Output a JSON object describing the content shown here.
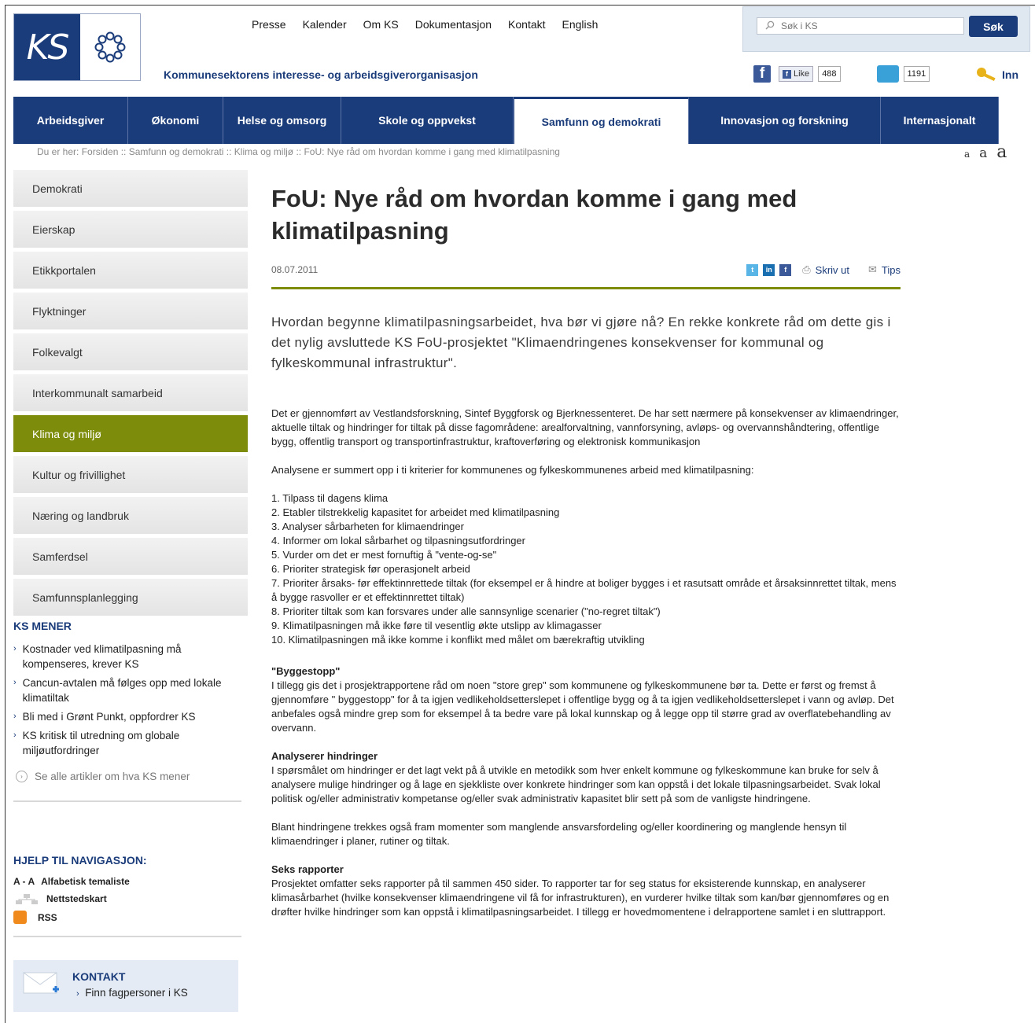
{
  "brand": {
    "logo_text": "KS",
    "tagline": "Kommunesektorens interesse- og arbeidsgiverorganisasjon"
  },
  "topnav": [
    "Presse",
    "Kalender",
    "Om KS",
    "Dokumentasjon",
    "Kontakt",
    "English"
  ],
  "search": {
    "placeholder": "Søk i KS",
    "button": "Søk"
  },
  "social": {
    "like_label": "Like",
    "like_count": "488",
    "tweet_count": "1191",
    "login": "Inn"
  },
  "mainnav": [
    "Arbeidsgiver",
    "Økonomi",
    "Helse og omsorg",
    "Skole og oppvekst",
    "Samfunn og demokrati",
    "Innovasjon og forskning",
    "Internasjonalt"
  ],
  "breadcrumb": "Du er her: Forsiden :: Samfunn og demokrati :: Klima og miljø :: FoU: Nye råd om hvordan komme i gang med klimatilpasning",
  "fontsize_glyph": "a",
  "sidebar": [
    "Demokrati",
    "Eierskap",
    "Etikkportalen",
    "Flyktninger",
    "Folkevalgt",
    "Interkommunalt samarbeid",
    "Klima og miljø",
    "Kultur og frivillighet",
    "Næring og landbruk",
    "Samferdsel",
    "Samfunnsplanlegging"
  ],
  "ks_mener": {
    "heading": "KS MENER",
    "items": [
      "Kostnader ved klimatilpasning må kompenseres, krever KS",
      "Cancun-avtalen må følges opp med lokale klimatiltak",
      "Bli med i Grønt Punkt, oppfordrer KS",
      "KS kritisk til utredning om globale miljøutfordringer"
    ],
    "see_all": "Se alle artikler om hva KS mener"
  },
  "help": {
    "heading": "HJELP TIL NAVIGASJON:",
    "az_label": "A - A",
    "alphabetic": "Alfabetisk temaliste",
    "sitemap": "Nettstedskart",
    "rss": "RSS"
  },
  "kontakt": {
    "title": "KONTAKT",
    "link": "Finn fagpersoner i KS"
  },
  "article": {
    "title": "FoU: Nye råd om hvordan komme i gang med klimatilpasning",
    "date": "08.07.2011",
    "print": "Skriv ut",
    "tips": "Tips",
    "lead": "Hvordan begynne klimatilpasningsarbeidet, hva bør vi gjøre nå? En rekke konkrete råd om dette gis i det nylig avsluttede KS FoU-prosjektet \"Klimaendringenes konsekvenser for kommunal og fylkeskommunal infrastruktur\".",
    "p1": "Det er gjennomført av Vestlandsforskning, Sintef Byggforsk og Bjerknessenteret. De har sett nærmere på konsekvenser av klimaendringer, aktuelle tiltak og hindringer for tiltak på disse fagområdene: arealforvaltning, vannforsyning, avløps- og overvannshåndtering, offentlige bygg, offentlig transport og transportinfrastruktur, kraftoverføring og elektronisk kommunikasjon",
    "p2": "Analysene er summert opp i ti kriterier for kommunenes og fylkeskommunenes arbeid med klimatilpasning:",
    "criteria": [
      "1. Tilpass til dagens klima",
      "2. Etabler tilstrekkelig kapasitet for arbeidet med klimatilpasning",
      "3. Analyser sårbarheten for klimaendringer",
      "4. Informer om lokal sårbarhet og tilpasningsutfordringer",
      "5. Vurder om det er mest fornuftig å \"vente-og-se\"",
      "6. Prioriter strategisk før operasjonelt arbeid",
      "7. Prioriter årsaks- før effektinnrettede tiltak (for eksempel er å hindre at boliger bygges i et rasutsatt område et årsaksinnrettet tiltak, mens å bygge rasvoller er et effektinnrettet tiltak)",
      "8. Prioriter tiltak som kan forsvares under alle sannsynlige scenarier (\"no-regret tiltak\")",
      "9. Klimatilpasningen må ikke føre til vesentlig økte utslipp av klimagasser",
      "10. Klimatilpasningen må ikke komme i konflikt med målet om bærekraftig utvikling"
    ],
    "h1": "\"Byggestopp\"",
    "p3": "I tillegg gis det i prosjektrapportene råd om noen \"store grep\" som kommunene og fylkeskommunene bør ta. Dette er først og fremst å gjennomføre \" byggestopp\" for å ta igjen vedlikeholdsetterslepet i offentlige bygg og å ta igjen vedlikeholdsetterslepet i vann og avløp. Det anbefales også mindre grep som for eksempel å ta bedre vare på lokal kunnskap og å legge opp til større grad av overflatebehandling av overvann.",
    "h2": "Analyserer hindringer",
    "p4": "I spørsmålet om hindringer er det lagt vekt på å utvikle en metodikk som hver enkelt kommune og fylkeskommune kan bruke for selv å analysere mulige hindringer og å lage en sjekkliste over konkrete hindringer som kan oppstå i det lokale tilpasningsarbeidet. Svak lokal politisk og/eller administrativ kompetanse og/eller svak administrativ kapasitet blir sett på som de vanligste hindringene.",
    "p5": "Blant hindringene trekkes også fram momenter som manglende ansvarsfordeling og/eller koordinering og manglende hensyn til klimaendringer i planer, rutiner og tiltak.",
    "h3": "Seks rapporter",
    "p6": "Prosjektet omfatter seks rapporter på til sammen 450 sider. To rapporter tar for seg status for eksisterende kunnskap, en analyserer klimasårbarhet (hvilke konsekvenser klimaendringene vil få for infrastrukturen), en vurderer hvilke tiltak som kan/bør gjennomføres og en drøfter hvilke hindringer som kan oppstå i klimatilpasningsarbeidet. I tillegg er hovedmomentene i delrapportene samlet i en sluttrapport."
  },
  "colors": {
    "brand_blue": "#1b3c7a",
    "accent_green": "#7d8c0a"
  }
}
